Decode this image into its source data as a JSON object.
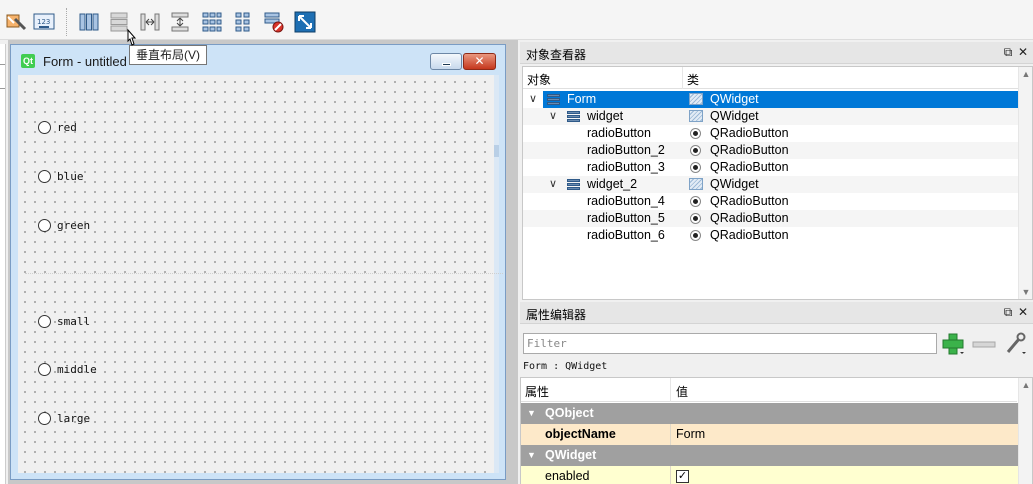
{
  "toolbar": {
    "buttons": [
      {
        "name": "edit-tab-order-icon"
      },
      {
        "name": "edit-buddies-icon"
      },
      {
        "name": "layout-horizontal-icon"
      },
      {
        "name": "layout-vertical-icon"
      },
      {
        "name": "layout-horizontal-splitter-icon"
      },
      {
        "name": "layout-vertical-splitter-icon"
      },
      {
        "name": "layout-form-icon"
      },
      {
        "name": "layout-grid-icon"
      },
      {
        "name": "break-layout-icon"
      },
      {
        "name": "adjust-size-icon"
      }
    ],
    "tooltip": "垂直布局(V)"
  },
  "form_window": {
    "title": "Form - untitled",
    "radios": [
      "red",
      "blue",
      "green",
      "small",
      "middle",
      "large"
    ]
  },
  "object_inspector": {
    "title": "对象查看器",
    "col_object": "对象",
    "col_class": "类",
    "rows": [
      {
        "name": "Form",
        "cls": "QWidget",
        "level": 0,
        "selected": true,
        "icon": "layout",
        "expand": "∨"
      },
      {
        "name": "widget",
        "cls": "QWidget",
        "level": 1,
        "selected": false,
        "icon": "layout",
        "expand": "∨"
      },
      {
        "name": "radioButton",
        "cls": "QRadioButton",
        "level": 2,
        "selected": false,
        "icon": "none",
        "expand": ""
      },
      {
        "name": "radioButton_2",
        "cls": "QRadioButton",
        "level": 2,
        "selected": false,
        "icon": "none",
        "expand": ""
      },
      {
        "name": "radioButton_3",
        "cls": "QRadioButton",
        "level": 2,
        "selected": false,
        "icon": "none",
        "expand": ""
      },
      {
        "name": "widget_2",
        "cls": "QWidget",
        "level": 1,
        "selected": false,
        "icon": "layout",
        "expand": "∨"
      },
      {
        "name": "radioButton_4",
        "cls": "QRadioButton",
        "level": 2,
        "selected": false,
        "icon": "none",
        "expand": ""
      },
      {
        "name": "radioButton_5",
        "cls": "QRadioButton",
        "level": 2,
        "selected": false,
        "icon": "none",
        "expand": ""
      },
      {
        "name": "radioButton_6",
        "cls": "QRadioButton",
        "level": 2,
        "selected": false,
        "icon": "none",
        "expand": ""
      }
    ]
  },
  "property_editor": {
    "title": "属性编辑器",
    "filter_placeholder": "Filter",
    "current": "Form : QWidget",
    "col_property": "属性",
    "col_value": "值",
    "group_qobject": "QObject",
    "objectname_label": "objectName",
    "objectname_value": "Form",
    "group_qwidget": "QWidget",
    "enabled_label": "enabled",
    "enabled_checked": true
  },
  "dock_buttons": {
    "float": "⧉",
    "close": "✕"
  },
  "colors": {
    "selection": "#0078d7",
    "group_header": "#a0a0a0",
    "qobject_row": "#fde9c9",
    "qwidget_row": "#ffffd0"
  }
}
